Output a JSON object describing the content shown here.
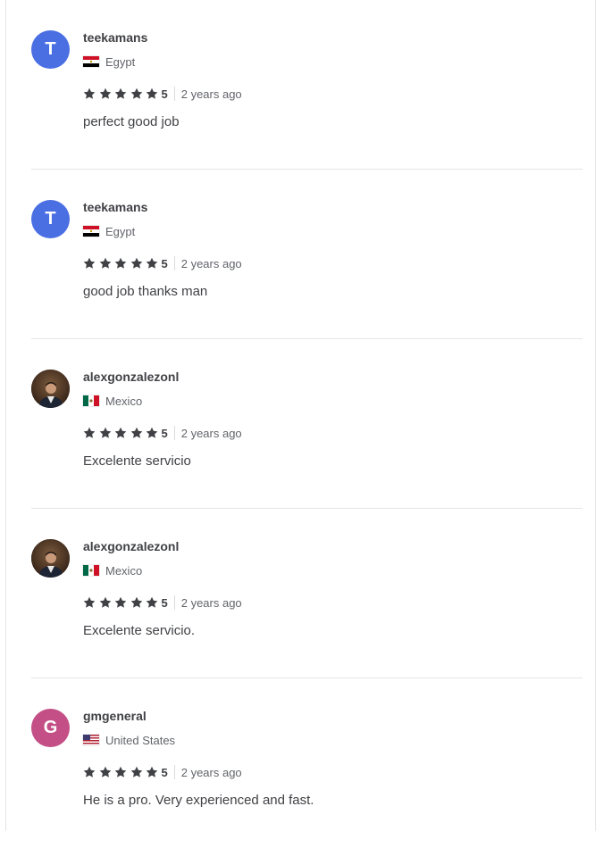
{
  "colors": {
    "text_primary": "#404145",
    "text_secondary": "#62646a",
    "star": "#404145",
    "divider": "#e4e5e7"
  },
  "reviews": [
    {
      "avatar_letter": "T",
      "avatar_color": "#4a6fe3",
      "avatar_type": "letter",
      "username": "teekamans",
      "flag_icon": "egypt-flag-icon",
      "country": "Egypt",
      "rating": "5",
      "time": "2 years ago",
      "comment": "perfect good job"
    },
    {
      "avatar_letter": "T",
      "avatar_color": "#4a6fe3",
      "avatar_type": "letter",
      "username": "teekamans",
      "flag_icon": "egypt-flag-icon",
      "country": "Egypt",
      "rating": "5",
      "time": "2 years ago",
      "comment": "good job thanks man"
    },
    {
      "avatar_type": "photo",
      "username": "alexgonzalezonl",
      "flag_icon": "mexico-flag-icon",
      "country": "Mexico",
      "rating": "5",
      "time": "2 years ago",
      "comment": "Excelente servicio"
    },
    {
      "avatar_type": "photo",
      "username": "alexgonzalezonl",
      "flag_icon": "mexico-flag-icon",
      "country": "Mexico",
      "rating": "5",
      "time": "2 years ago",
      "comment": "Excelente servicio."
    },
    {
      "avatar_letter": "G",
      "avatar_color": "#c44f86",
      "avatar_type": "letter",
      "username": "gmgeneral",
      "flag_icon": "us-flag-icon",
      "country": "United States",
      "rating": "5",
      "time": "2 years ago",
      "comment": "He is a pro. Very experienced and fast."
    }
  ]
}
